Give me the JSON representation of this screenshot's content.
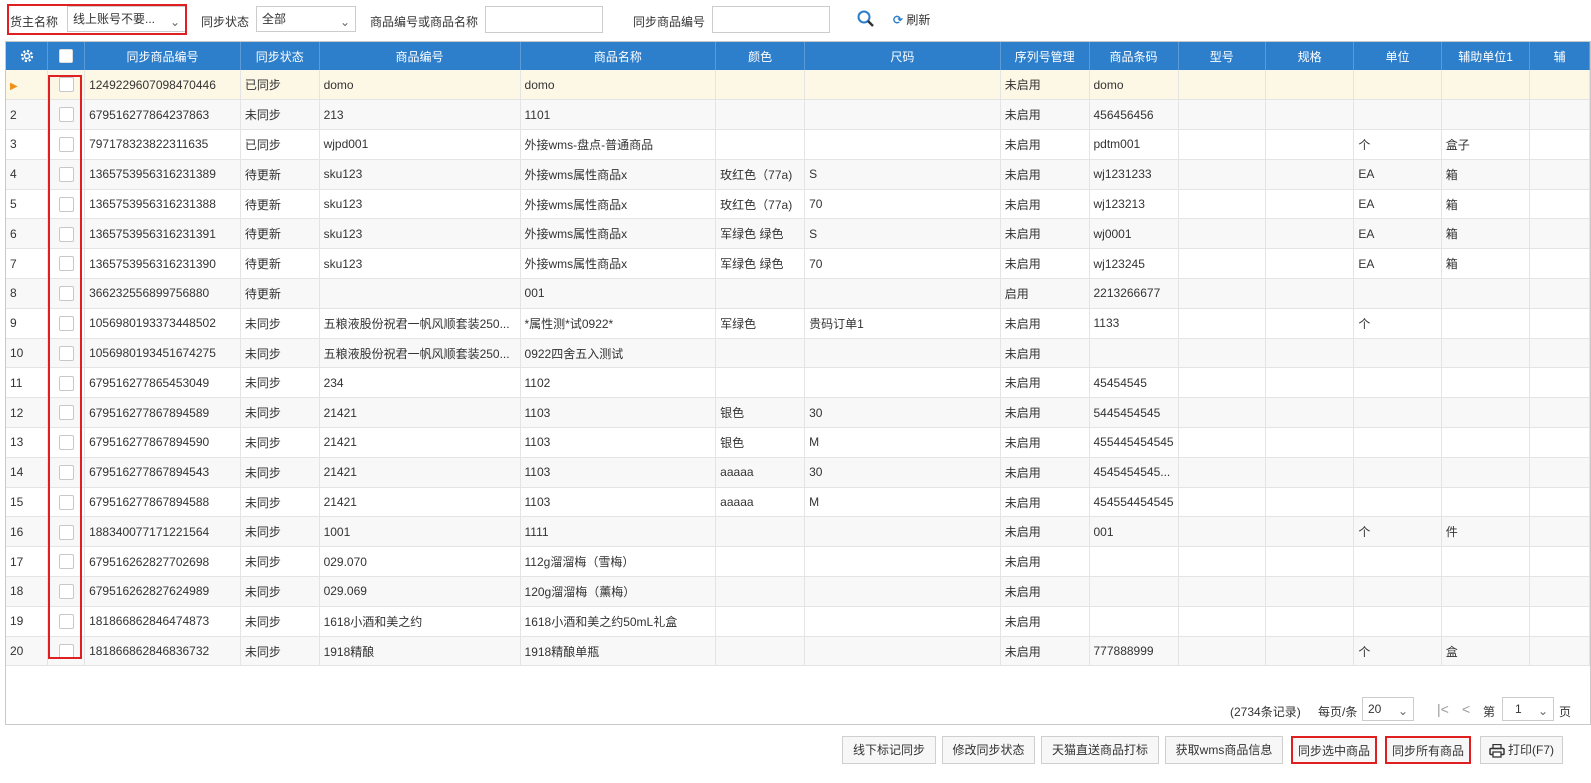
{
  "filters": {
    "owner_label": "货主名称",
    "owner_value": "线上账号不要...",
    "status_label": "同步状态",
    "status_value": "全部",
    "code_label": "商品编号或商品名称",
    "code_value": "",
    "sync_code_label": "同步商品编号",
    "sync_code_value": "",
    "refresh_label": "刷新"
  },
  "columns": [
    "同步商品编号",
    "同步状态",
    "商品编号",
    "商品名称",
    "颜色",
    "尺码",
    "序列号管理",
    "商品条码",
    "型号",
    "规格",
    "单位",
    "辅助单位1",
    "辅"
  ],
  "rows": [
    {
      "no": "",
      "sync_code": "1249229607098470446",
      "status": "已同步",
      "code": "domo",
      "name": "domo",
      "color": "",
      "size": "",
      "serial": "未启用",
      "barcode": "domo",
      "unit": "",
      "aux": ""
    },
    {
      "no": "2",
      "sync_code": "679516277864237863",
      "status": "未同步",
      "code": "213",
      "name": "1101",
      "color": "",
      "size": "",
      "serial": "未启用",
      "barcode": "456456456",
      "unit": "",
      "aux": ""
    },
    {
      "no": "3",
      "sync_code": "797178323822311635",
      "status": "已同步",
      "code": "wjpd001",
      "name": "外接wms-盘点-普通商品",
      "color": "",
      "size": "",
      "serial": "未启用",
      "barcode": "pdtm001",
      "unit": "个",
      "aux": "盒子"
    },
    {
      "no": "4",
      "sync_code": "1365753956316231389",
      "status": "待更新",
      "code": "sku123",
      "name": "外接wms属性商品x",
      "color": "玫红色（77a)",
      "size": "S",
      "serial": "未启用",
      "barcode": "wj1231233",
      "unit": "EA",
      "aux": "箱"
    },
    {
      "no": "5",
      "sync_code": "1365753956316231388",
      "status": "待更新",
      "code": "sku123",
      "name": "外接wms属性商品x",
      "color": "玫红色（77a)",
      "size": "70",
      "serial": "未启用",
      "barcode": "wj123213",
      "unit": "EA",
      "aux": "箱"
    },
    {
      "no": "6",
      "sync_code": "1365753956316231391",
      "status": "待更新",
      "code": "sku123",
      "name": "外接wms属性商品x",
      "color": "军绿色 绿色",
      "size": "S",
      "serial": "未启用",
      "barcode": "wj0001",
      "unit": "EA",
      "aux": "箱"
    },
    {
      "no": "7",
      "sync_code": "1365753956316231390",
      "status": "待更新",
      "code": "sku123",
      "name": "外接wms属性商品x",
      "color": "军绿色 绿色",
      "size": "70",
      "serial": "未启用",
      "barcode": "wj123245",
      "unit": "EA",
      "aux": "箱"
    },
    {
      "no": "8",
      "sync_code": "366232556899756880",
      "status": "待更新",
      "code": "",
      "name": "001",
      "color": "",
      "size": "",
      "serial": "启用",
      "barcode": "2213266677",
      "unit": "",
      "aux": ""
    },
    {
      "no": "9",
      "sync_code": "1056980193373448502",
      "status": "未同步",
      "code": "五粮液股份祝君一帆风顺套装250...",
      "name": "*属性测*试0922*",
      "color": "军绿色",
      "size": "贵码订单1",
      "serial": "未启用",
      "barcode": "1133",
      "unit": "个",
      "aux": ""
    },
    {
      "no": "10",
      "sync_code": "1056980193451674275",
      "status": "未同步",
      "code": "五粮液股份祝君一帆风顺套装250...",
      "name": "0922四舍五入测试",
      "color": "",
      "size": "",
      "serial": "未启用",
      "barcode": "",
      "unit": "",
      "aux": ""
    },
    {
      "no": "11",
      "sync_code": "679516277865453049",
      "status": "未同步",
      "code": "234",
      "name": "1102",
      "color": "",
      "size": "",
      "serial": "未启用",
      "barcode": "45454545",
      "unit": "",
      "aux": ""
    },
    {
      "no": "12",
      "sync_code": "679516277867894589",
      "status": "未同步",
      "code": "21421",
      "name": "1103",
      "color": "银色",
      "size": "30",
      "serial": "未启用",
      "barcode": "5445454545",
      "unit": "",
      "aux": ""
    },
    {
      "no": "13",
      "sync_code": "679516277867894590",
      "status": "未同步",
      "code": "21421",
      "name": "1103",
      "color": "银色",
      "size": "M",
      "serial": "未启用",
      "barcode": "455445454545",
      "unit": "",
      "aux": ""
    },
    {
      "no": "14",
      "sync_code": "679516277867894543",
      "status": "未同步",
      "code": "21421",
      "name": "1103",
      "color": "aaaaa",
      "size": "30",
      "serial": "未启用",
      "barcode": "4545454545...",
      "unit": "",
      "aux": ""
    },
    {
      "no": "15",
      "sync_code": "679516277867894588",
      "status": "未同步",
      "code": "21421",
      "name": "1103",
      "color": "aaaaa",
      "size": "M",
      "serial": "未启用",
      "barcode": "454554454545",
      "unit": "",
      "aux": ""
    },
    {
      "no": "16",
      "sync_code": "188340077171221564",
      "status": "未同步",
      "code": "1001",
      "name": "1111",
      "color": "",
      "size": "",
      "serial": "未启用",
      "barcode": "001",
      "unit": "个",
      "aux": "件"
    },
    {
      "no": "17",
      "sync_code": "679516262827702698",
      "status": "未同步",
      "code": "029.070",
      "name": "112g溜溜梅（雪梅）",
      "color": "",
      "size": "",
      "serial": "未启用",
      "barcode": "",
      "unit": "",
      "aux": ""
    },
    {
      "no": "18",
      "sync_code": "679516262827624989",
      "status": "未同步",
      "code": "029.069",
      "name": "120g溜溜梅（薰梅）",
      "color": "",
      "size": "",
      "serial": "未启用",
      "barcode": "",
      "unit": "",
      "aux": ""
    },
    {
      "no": "19",
      "sync_code": "181866862846474873",
      "status": "未同步",
      "code": "1618小酒和美之约",
      "name": "1618小酒和美之约50mL礼盒",
      "color": "",
      "size": "",
      "serial": "未启用",
      "barcode": "",
      "unit": "",
      "aux": ""
    },
    {
      "no": "20",
      "sync_code": "181866862846836732",
      "status": "未同步",
      "code": "1918精酿",
      "name": "1918精酿单瓶",
      "color": "",
      "size": "",
      "serial": "未启用",
      "barcode": "777888999",
      "unit": "个",
      "aux": "盒"
    }
  ],
  "pager": {
    "records": "(2734条记录)",
    "per_page_label": "每页/条",
    "per_page_value": "20",
    "page_label": "第",
    "page_value": "1",
    "page_suffix": "页"
  },
  "buttons": {
    "offline_mark": "线下标记同步",
    "modify_status": "修改同步状态",
    "tmall_print": "天猫直送商品打标",
    "get_wms": "获取wms商品信息",
    "sync_selected": "同步选中商品",
    "sync_all": "同步所有商品",
    "print": "打印(F7)"
  },
  "colors": {
    "header_bg": "#2d7fcc",
    "highlight_red": "#e02020",
    "active_row": "#fdf8e6"
  }
}
